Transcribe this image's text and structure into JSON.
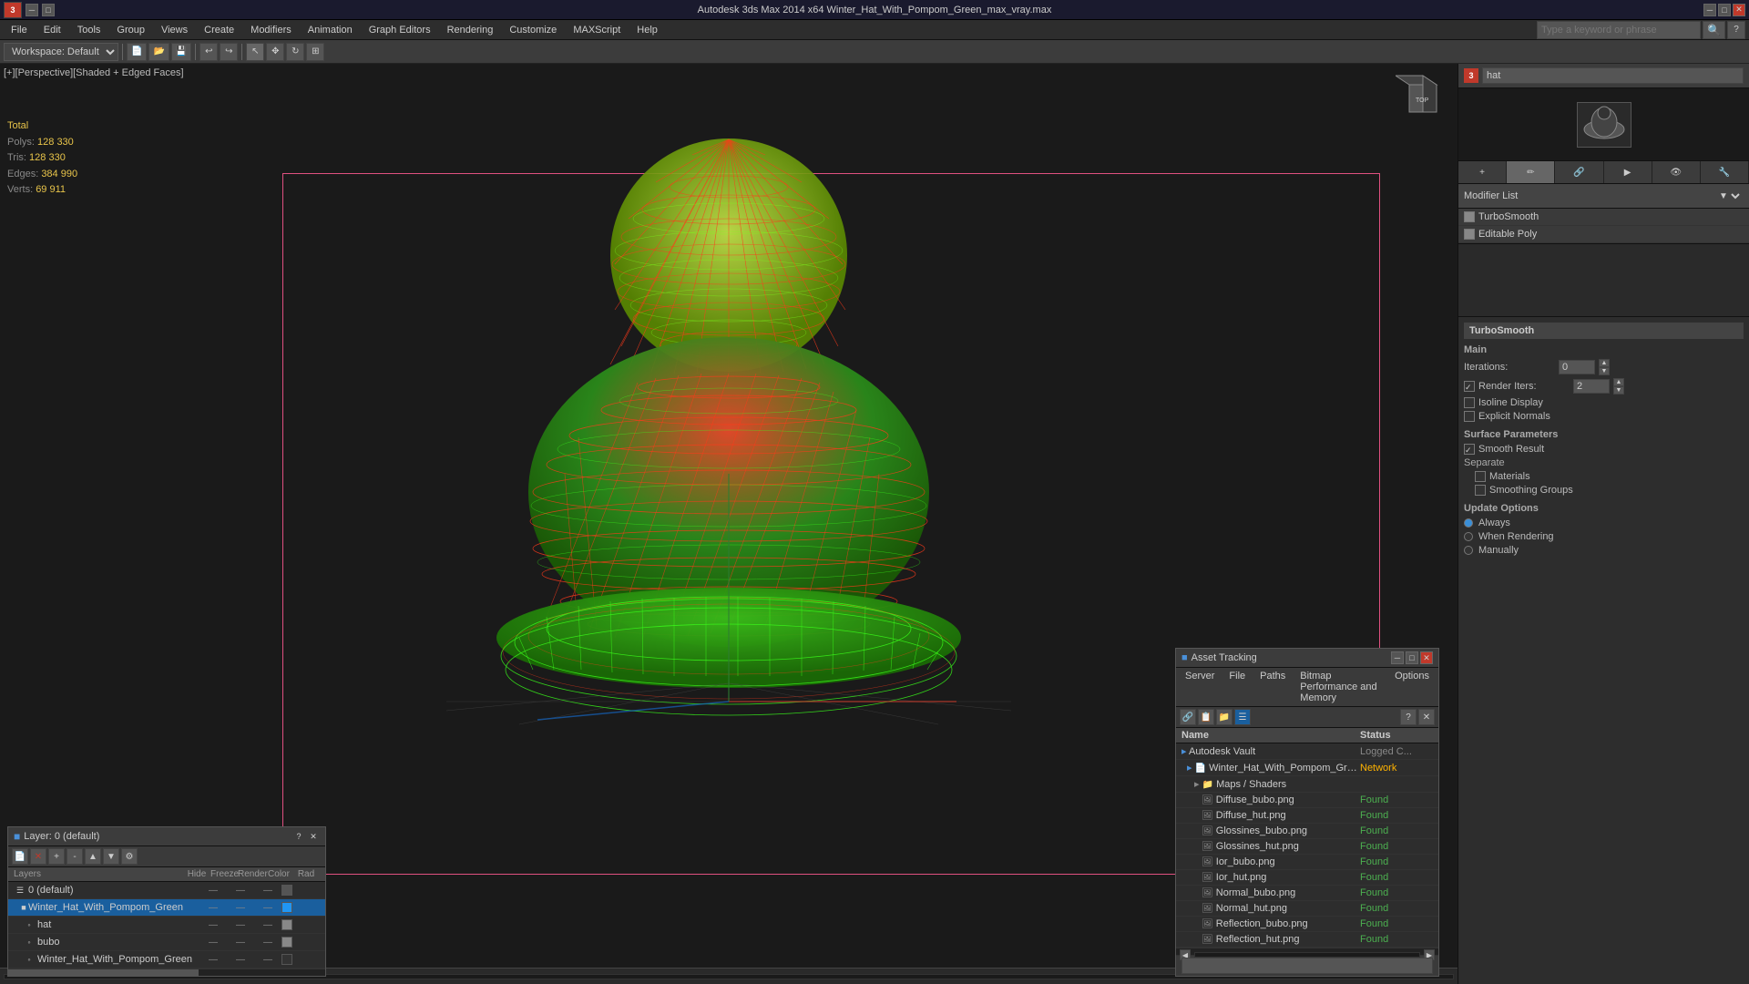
{
  "titlebar": {
    "title": "Autodesk 3ds Max 2014 x64    Winter_Hat_With_Pompom_Green_max_vray.max",
    "minimize": "─",
    "maximize": "□",
    "close": "✕"
  },
  "toolbar": {
    "workspace_label": "Workspace: Default",
    "search_placeholder": "Type a keyword or phrase"
  },
  "menubar": {
    "items": [
      "File",
      "Edit",
      "Tools",
      "Group",
      "Views",
      "Create",
      "Modifiers",
      "Animation",
      "Graph Editors",
      "Rendering",
      "Animation",
      "Customize",
      "MAXScript",
      "Help"
    ]
  },
  "viewport": {
    "label": "[+][Perspective][Shaded + Edged Faces]",
    "stats": {
      "total": "Total",
      "polys_label": "Polys:",
      "polys_value": "128 330",
      "tris_label": "Tris:",
      "tris_value": "128 330",
      "edges_label": "Edges:",
      "edges_value": "384 990",
      "verts_label": "Verts:",
      "verts_value": "69 911"
    }
  },
  "right_panel": {
    "search_value": "hat",
    "modifier_list_label": "Modifier List",
    "modifiers": [
      {
        "name": "TurboSmooth",
        "enabled": true,
        "selected": false
      },
      {
        "name": "Editable Poly",
        "enabled": true,
        "selected": false
      }
    ],
    "turbosmooth": {
      "title": "TurboSmooth",
      "main_label": "Main",
      "iterations_label": "Iterations:",
      "iterations_value": "0",
      "render_iters_label": "Render Iters:",
      "render_iters_value": "2",
      "isoline_display_label": "Isoline Display",
      "explicit_normals_label": "Explicit Normals",
      "surface_params_label": "Surface Parameters",
      "smooth_result_label": "Smooth Result",
      "separate_label": "Separate",
      "materials_label": "Materials",
      "smoothing_groups_label": "Smoothing Groups",
      "update_options_label": "Update Options",
      "always_label": "Always",
      "when_rendering_label": "When Rendering",
      "manually_label": "Manually"
    }
  },
  "layers_panel": {
    "title": "Layer: 0 (default)",
    "help": "?",
    "close": "✕",
    "columns": {
      "name": "Layers",
      "hide": "Hide",
      "freeze": "Freeze",
      "render": "Render",
      "color": "Color",
      "rad": "Rad"
    },
    "layers": [
      {
        "id": "default",
        "name": "0 (default)",
        "level": 0,
        "active": false
      },
      {
        "id": "hat_group",
        "name": "Winter_Hat_With_Pompom_Green",
        "level": 1,
        "active": true
      },
      {
        "id": "hat",
        "name": "hat",
        "level": 2,
        "active": false
      },
      {
        "id": "bubo",
        "name": "bubo",
        "level": 2,
        "active": false
      },
      {
        "id": "hat_mesh",
        "name": "Winter_Hat_With_Pompom_Green",
        "level": 2,
        "active": false
      }
    ]
  },
  "asset_panel": {
    "title": "Asset Tracking",
    "minimize": "─",
    "maximize": "□",
    "close": "✕",
    "menus": [
      "Server",
      "File",
      "Paths",
      "Bitmap Performance and Memory",
      "Options"
    ],
    "columns": {
      "name": "Name",
      "status": "Status"
    },
    "assets": [
      {
        "name": "Autodesk Vault",
        "status": "Logged C...",
        "level": 0,
        "type": "vault"
      },
      {
        "name": "Winter_Hat_With_Pompom_Green_max_vray...",
        "status": "Network",
        "level": 1,
        "type": "file"
      },
      {
        "name": "Maps / Shaders",
        "status": "",
        "level": 2,
        "type": "folder"
      },
      {
        "name": "Diffuse_bubo.png",
        "status": "Found",
        "level": 3,
        "type": "image"
      },
      {
        "name": "Diffuse_hut.png",
        "status": "Found",
        "level": 3,
        "type": "image"
      },
      {
        "name": "Glossines_bubo.png",
        "status": "Found",
        "level": 3,
        "type": "image"
      },
      {
        "name": "Glossines_hut.png",
        "status": "Found",
        "level": 3,
        "type": "image"
      },
      {
        "name": "Ior_bubo.png",
        "status": "Found",
        "level": 3,
        "type": "image"
      },
      {
        "name": "Ior_hut.png",
        "status": "Found",
        "level": 3,
        "type": "image"
      },
      {
        "name": "Normal_bubo.png",
        "status": "Found",
        "level": 3,
        "type": "image"
      },
      {
        "name": "Normal_hut.png",
        "status": "Found",
        "level": 3,
        "type": "image"
      },
      {
        "name": "Reflection_bubo.png",
        "status": "Found",
        "level": 3,
        "type": "image"
      },
      {
        "name": "Reflection_hut.png",
        "status": "Found",
        "level": 3,
        "type": "image"
      }
    ]
  }
}
